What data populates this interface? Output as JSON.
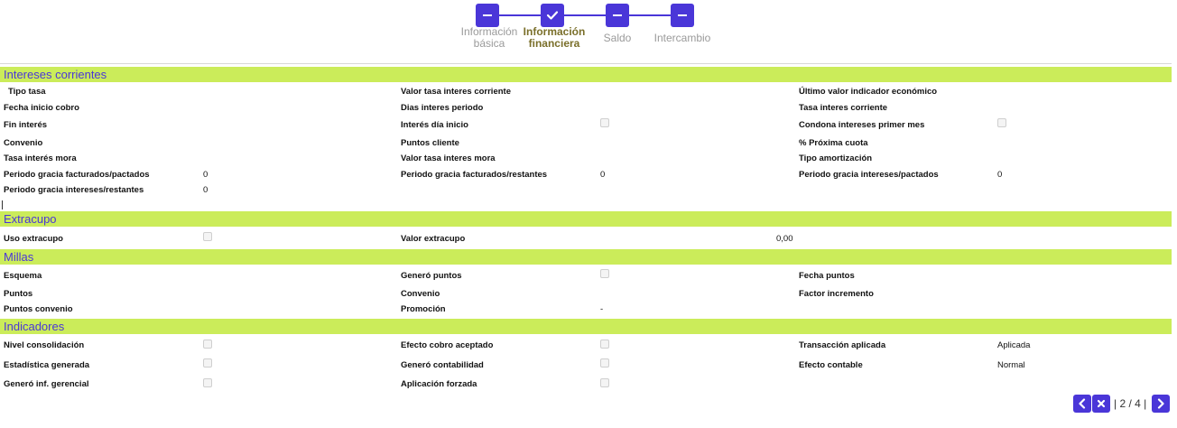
{
  "stepper": {
    "steps": [
      {
        "label_line1": "Información",
        "label_line2": "básica",
        "state": "pending"
      },
      {
        "label_line1": "Información",
        "label_line2": "financiera",
        "state": "done"
      },
      {
        "label_line1": "Saldo",
        "label_line2": "",
        "state": "pending"
      },
      {
        "label_line1": "Intercambio",
        "label_line2": "",
        "state": "pending"
      }
    ],
    "accent_color": "#4a36d8"
  },
  "sections": {
    "intereses": {
      "title": "Intereses corrientes",
      "fields": {
        "tipo_tasa": {
          "label": "Tipo tasa",
          "value": ""
        },
        "valor_tasa_interes_corriente": {
          "label": "Valor tasa interes corriente",
          "value": ""
        },
        "ultimo_valor_indicador": {
          "label": "Último valor indicador económico",
          "value": ""
        },
        "fecha_inicio_cobro": {
          "label": "Fecha inicio cobro",
          "value": ""
        },
        "dias_interes_periodo": {
          "label": "Dias interes periodo",
          "value": ""
        },
        "tasa_interes_corriente": {
          "label": "Tasa interes corriente",
          "value": ""
        },
        "fin_interes": {
          "label": "Fin interés",
          "value": ""
        },
        "interes_dia_inicio": {
          "label": "Interés día inicio",
          "checked": false
        },
        "condona_intereses": {
          "label": "Condona intereses primer mes",
          "checked": false
        },
        "convenio": {
          "label": "Convenio",
          "value": ""
        },
        "puntos_cliente": {
          "label": "Puntos cliente",
          "value": ""
        },
        "pct_proxima_cuota": {
          "label": "% Próxima cuota",
          "value": ""
        },
        "tasa_interes_mora": {
          "label": "Tasa interés mora",
          "value": ""
        },
        "valor_tasa_interes_mora": {
          "label": "Valor tasa interes mora",
          "value": ""
        },
        "tipo_amortizacion": {
          "label": "Tipo amortización",
          "value": ""
        },
        "pg_facturados_pactados": {
          "label": "Periodo gracia facturados/pactados",
          "value": "0"
        },
        "pg_facturados_restantes": {
          "label": "Periodo gracia facturados/restantes",
          "value": "0"
        },
        "pg_intereses_pactados": {
          "label": "Periodo gracia intereses/pactados",
          "value": "0"
        },
        "pg_intereses_restantes": {
          "label": "Periodo gracia intereses/restantes",
          "value": "0"
        }
      }
    },
    "extracupo": {
      "title": "Extracupo",
      "fields": {
        "uso_extracupo": {
          "label": "Uso extracupo",
          "checked": false
        },
        "valor_extracupo": {
          "label": "Valor extracupo",
          "value": "0,00"
        }
      }
    },
    "millas": {
      "title": "Millas",
      "fields": {
        "esquema": {
          "label": "Esquema",
          "value": ""
        },
        "genero_puntos": {
          "label": "Generó puntos",
          "checked": false
        },
        "fecha_puntos": {
          "label": "Fecha puntos",
          "value": ""
        },
        "puntos": {
          "label": "Puntos",
          "value": ""
        },
        "convenio": {
          "label": "Convenio",
          "value": ""
        },
        "factor_incremento": {
          "label": "Factor incremento",
          "value": ""
        },
        "puntos_convenio": {
          "label": "Puntos convenio",
          "value": ""
        },
        "promocion": {
          "label": "Promoción",
          "value": "-"
        }
      }
    },
    "indicadores": {
      "title": "Indicadores",
      "fields": {
        "nivel_consolidacion": {
          "label": "Nivel consolidación",
          "checked": false
        },
        "efecto_cobro_aceptado": {
          "label": "Efecto cobro aceptado",
          "checked": false
        },
        "transaccion_aplicada": {
          "label": "Transacción aplicada",
          "value": "Aplicada"
        },
        "estadistica_generada": {
          "label": "Estadística generada",
          "checked": false
        },
        "genero_contabilidad": {
          "label": "Generó contabilidad",
          "checked": false
        },
        "efecto_contable": {
          "label": "Efecto contable",
          "value": "Normal"
        },
        "genero_inf_gerencial": {
          "label": "Generó inf. gerencial",
          "checked": false
        },
        "aplicacion_forzada": {
          "label": "Aplicación forzada",
          "checked": false
        }
      }
    }
  },
  "pager": {
    "current": "2",
    "total": "4",
    "text": "| 2 / 4 |"
  },
  "colors": {
    "section_bg": "#cbec5a",
    "section_title": "#4a36d8",
    "button_bg": "#4a36d8"
  }
}
